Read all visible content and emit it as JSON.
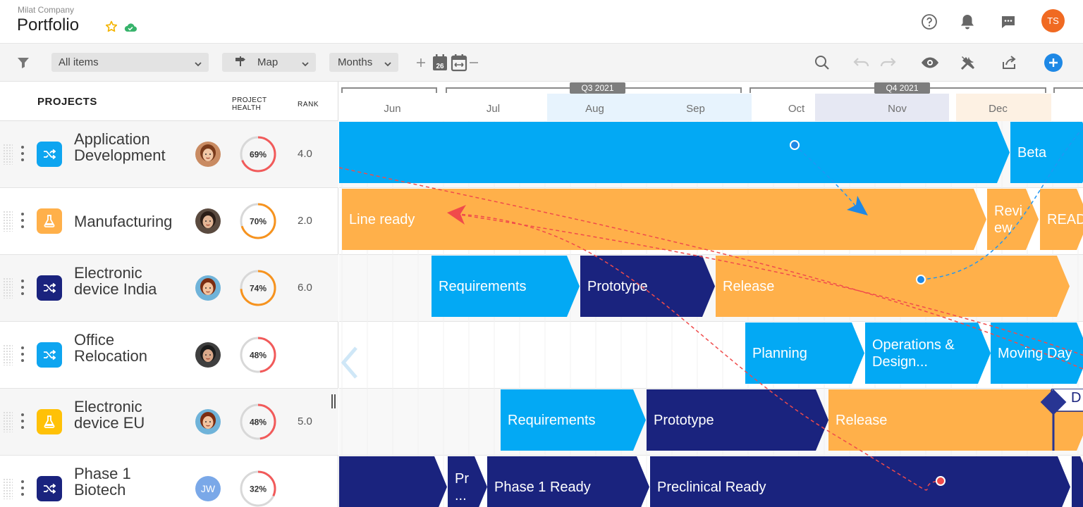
{
  "header": {
    "company": "Milat Company",
    "title": "Portfolio",
    "user_initials": "TS",
    "icons": [
      "help-icon",
      "bell-icon",
      "chat-icon"
    ]
  },
  "toolbar": {
    "filter_select": "All items",
    "view_select": "Map",
    "scale_select": "Months",
    "calendar_day": "26"
  },
  "columns": {
    "projects": "PROJECTS",
    "health_line1": "PROJECT",
    "health_line2": "HEALTH",
    "rank": "RANK"
  },
  "projects": [
    {
      "name_line1": "Application",
      "name_line2": "Development",
      "health": "69%",
      "health_value": 0.69,
      "rank": "4.0",
      "icon": "shuffle-icon",
      "icon_color": "#0ea5f0",
      "health_color": "#f25a5a"
    },
    {
      "name_line1": "Manufacturing",
      "name_line2": "",
      "health": "70%",
      "health_value": 0.7,
      "rank": "2.0",
      "icon": "flask-icon",
      "icon_color": "#ffb04a",
      "health_color": "#f7931e"
    },
    {
      "name_line1": "Electronic",
      "name_line2": "device India",
      "health": "74%",
      "health_value": 0.74,
      "rank": "6.0",
      "icon": "shuffle-icon",
      "icon_color": "#1a237e",
      "health_color": "#f7931e"
    },
    {
      "name_line1": "Office",
      "name_line2": "Relocation",
      "health": "48%",
      "health_value": 0.48,
      "rank": "",
      "icon": "shuffle-icon",
      "icon_color": "#0ea5f0",
      "health_color": "#f25a5a"
    },
    {
      "name_line1": "Electronic",
      "name_line2": "device EU",
      "health": "48%",
      "health_value": 0.48,
      "rank": "5.0",
      "icon": "flask-icon",
      "icon_color": "#ffc107",
      "health_color": "#f25a5a"
    },
    {
      "name_line1": "Phase 1",
      "name_line2": "Biotech",
      "health": "32%",
      "health_value": 0.32,
      "rank": "",
      "icon": "shuffle-icon",
      "icon_color": "#1a237e",
      "health_color": "#f25a5a",
      "avatar_initials": "JW"
    }
  ],
  "timeline": {
    "months": [
      "Jun",
      "Jul",
      "Aug",
      "Sep",
      "Oct",
      "Nov",
      "Dec"
    ],
    "quarters": [
      "Q3 2021",
      "Q4 2021"
    ],
    "rows": [
      {
        "bars": [
          "",
          "Beta"
        ]
      },
      {
        "bars": [
          "Line ready",
          "Revi ew",
          "READ"
        ]
      },
      {
        "bars": [
          "Requirements",
          "Prototype",
          "Release"
        ]
      },
      {
        "bars": [
          "Planning",
          "Operations & Design...",
          "Moving Day"
        ]
      },
      {
        "bars": [
          "Requirements",
          "Prototype",
          "Release"
        ],
        "milestone": "D"
      },
      {
        "bars": [
          "",
          "Pr ...",
          "Phase 1 Ready",
          "Preclinical Ready"
        ]
      }
    ]
  }
}
